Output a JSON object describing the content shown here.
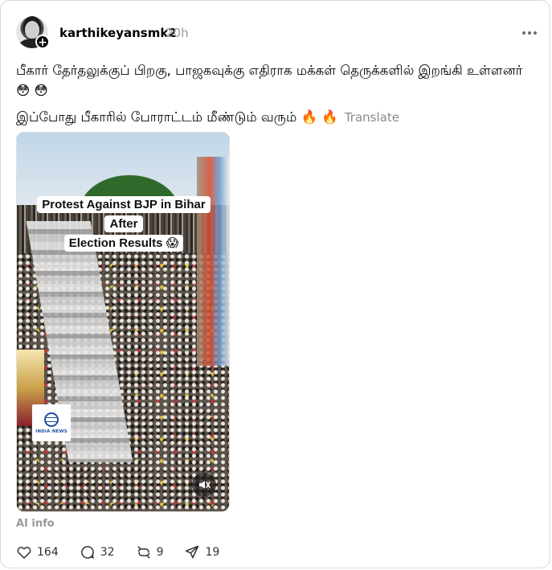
{
  "post": {
    "username": "karthikeyansmk2",
    "timestamp": "20h",
    "text_line1": "பீகார் தேர்தலுக்குப் பிறகு, பாஜகவுக்கு எதிராக மக்கள் தெருக்களில் இறங்கி உள்ளனர் 😳 😳",
    "text_line2": "இப்போது பீகாரில் போராட்டம் மீண்டும் வரும் 🔥 🔥",
    "translate_label": "Translate"
  },
  "media": {
    "caption_line1": "Protest Against BJP in Bihar After",
    "caption_line2": "Election Results 😱",
    "watermark_text": "INDIA NEWS"
  },
  "footer": {
    "ai_info_label": "AI info",
    "likes": "164",
    "replies": "32",
    "reposts": "9",
    "shares": "19"
  },
  "icons": [
    "avatar-plus-icon",
    "more-icon",
    "mute-icon",
    "heart-icon",
    "comment-icon",
    "repost-icon",
    "share-icon"
  ]
}
